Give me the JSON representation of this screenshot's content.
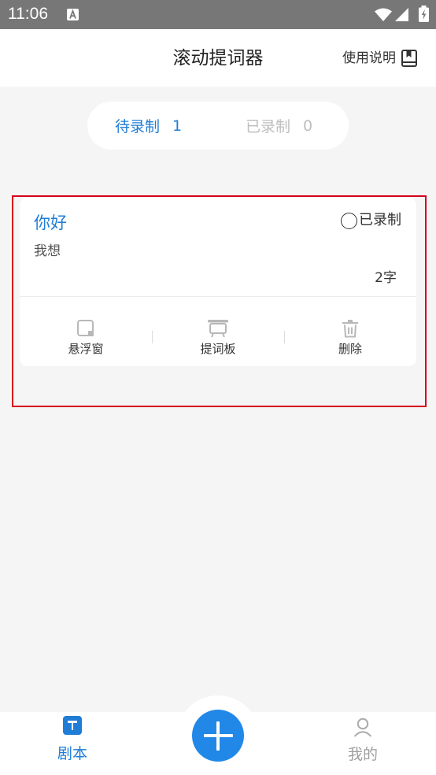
{
  "status_bar": {
    "time": "11:06",
    "icons": [
      "notification-a-icon",
      "wifi-icon",
      "cellular-signal-icon",
      "battery-charging-icon"
    ]
  },
  "header": {
    "title": "滚动提词器",
    "help_label": "使用说明",
    "help_icon": "book-icon"
  },
  "tabs": [
    {
      "label": "待录制",
      "count": "1",
      "active": true
    },
    {
      "label": "已录制",
      "count": "0",
      "active": false
    }
  ],
  "scripts": [
    {
      "title": "你好",
      "recorded_label": "已录制",
      "recorded": false,
      "content": "我想",
      "word_count": "2字",
      "actions": [
        {
          "label": "悬浮窗",
          "icon": "floating-window-icon"
        },
        {
          "label": "提词板",
          "icon": "teleprompter-icon"
        },
        {
          "label": "删除",
          "icon": "trash-icon"
        }
      ]
    }
  ],
  "bottom_nav": {
    "items": [
      {
        "label": "剧本",
        "icon": "script-icon",
        "active": true
      },
      {
        "label": "我的",
        "icon": "user-icon",
        "active": false
      }
    ],
    "add_button_icon": "plus-icon"
  },
  "colors": {
    "accent": "#1f7dd6",
    "add_button": "#2188e8",
    "status_bar": "#777777",
    "background": "#f5f5f5",
    "highlight_border": "#d6001c",
    "inactive_text": "#bdbdbd",
    "icon_gray": "#b8b8b8"
  }
}
